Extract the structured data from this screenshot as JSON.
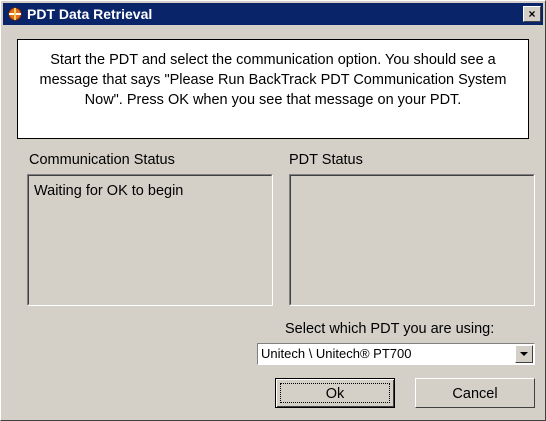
{
  "window": {
    "title": "PDT Data Retrieval",
    "close_label": "×"
  },
  "message": "Start the PDT and select the communication option.  You should see a message that says \"Please Run BackTrack PDT Communication System Now\".  Press OK when you see that message on your PDT.",
  "communication_status": {
    "label": "Communication Status",
    "value": "Waiting for OK to begin"
  },
  "pdt_status": {
    "label": "PDT Status",
    "value": ""
  },
  "pdt_select": {
    "label": "Select which PDT you are using:",
    "value": "Unitech \\ Unitech® PT700"
  },
  "buttons": {
    "ok_label": "Ok",
    "cancel_label": "Cancel"
  }
}
